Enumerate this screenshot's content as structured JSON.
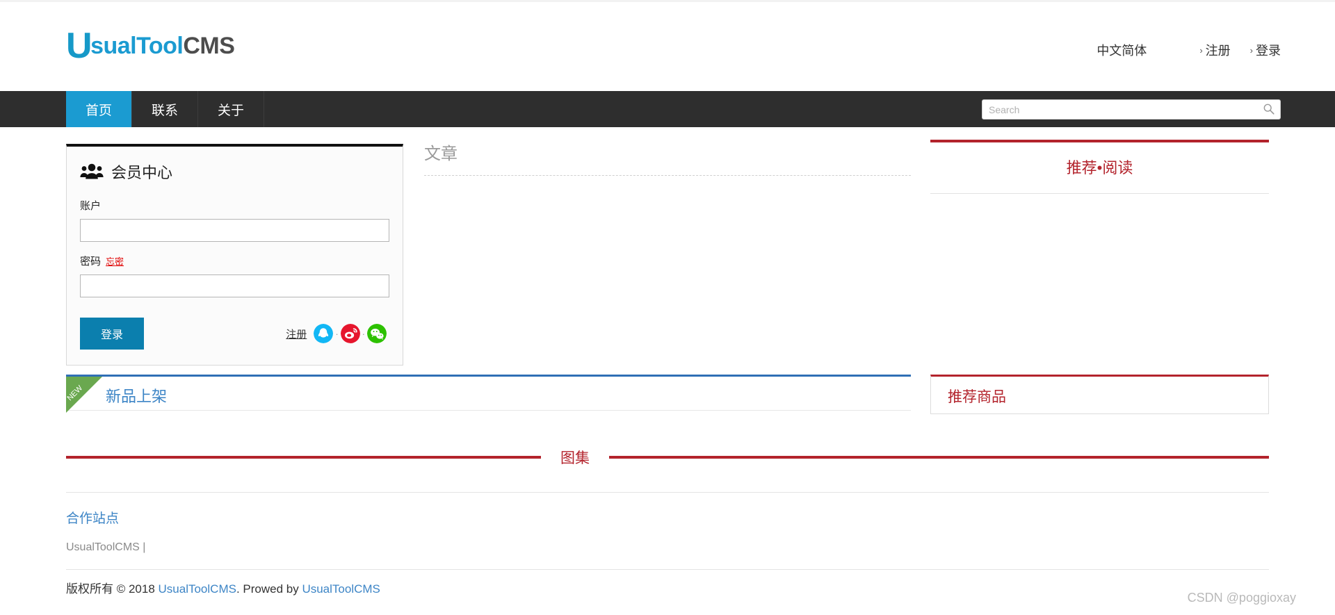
{
  "header": {
    "logo": {
      "u": "U",
      "blue": "sualTool",
      "gray": "CMS"
    },
    "lang": "中文简体",
    "chevron": "›",
    "register": "注册",
    "login": "登录"
  },
  "nav": {
    "items": [
      {
        "label": "首页",
        "active": true
      },
      {
        "label": "联系",
        "active": false
      },
      {
        "label": "关于",
        "active": false
      }
    ],
    "search": {
      "value": "",
      "placeholder": "Search",
      "icon": "search-icon"
    }
  },
  "login_panel": {
    "icon": "users-icon",
    "title": "会员中心",
    "account_label": "账户",
    "account_value": "",
    "password_label": "密码",
    "forgot_label": "忘密",
    "password_value": "",
    "submit_label": "登录",
    "register_label": "注册",
    "separator": "·",
    "social": [
      {
        "name": "qq-icon",
        "color": "#12b7f5"
      },
      {
        "name": "weibo-icon",
        "color": "#e6162d"
      },
      {
        "name": "wechat-icon",
        "color": "#2dc100"
      }
    ]
  },
  "article_section": {
    "title": "文章"
  },
  "side_read": {
    "title": "推荐•阅读",
    "accent": "#b3232c"
  },
  "new_arrivals": {
    "ribbon": "NEW",
    "title": "新品上架",
    "accent": "#2f6fb5"
  },
  "rec_products": {
    "title": "推荐商品",
    "accent": "#b3232c"
  },
  "gallery": {
    "label": "图集",
    "accent": "#b3232c"
  },
  "partners": {
    "title": "合作站点",
    "list": "UsualToolCMS |"
  },
  "footer": {
    "copyright_prefix": "版权所有 © 2018 ",
    "link1": "UsualToolCMS",
    "middle": ". Prowed by ",
    "link2": "UsualToolCMS"
  },
  "watermark": {
    "text": "CSDN @poggioxay"
  }
}
